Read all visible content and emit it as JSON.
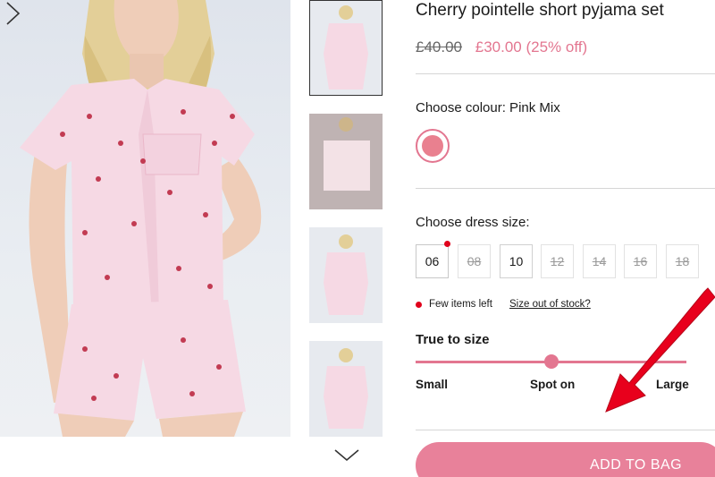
{
  "product": {
    "title": "Cherry pointelle short pyjama set",
    "price_old": "£40.00",
    "price_new": "£30.00 (25% off)"
  },
  "colour": {
    "label": "Choose colour: Pink Mix",
    "swatch_color": "#e9808f"
  },
  "size": {
    "label": "Choose dress size:",
    "options": [
      {
        "label": "06",
        "available": true
      },
      {
        "label": "08",
        "available": false
      },
      {
        "label": "10",
        "available": true
      },
      {
        "label": "12",
        "available": false
      },
      {
        "label": "14",
        "available": false
      },
      {
        "label": "16",
        "available": false
      },
      {
        "label": "18",
        "available": false
      }
    ],
    "stock_note": "Few items left",
    "out_of_stock_link": "Size out of stock?"
  },
  "fit": {
    "label": "True to size",
    "scale": [
      "Small",
      "Spot on",
      "Large"
    ],
    "value": 0.5
  },
  "actions": {
    "add_to_bag": "ADD TO BAG"
  },
  "colors": {
    "accent": "#e37690",
    "button": "#e8819a",
    "stock_dot": "#e0001b",
    "annotation_arrow": "#e8001c"
  },
  "icons": {
    "main_next": "chevron-right-icon",
    "thumbs_down": "chevron-down-icon"
  }
}
